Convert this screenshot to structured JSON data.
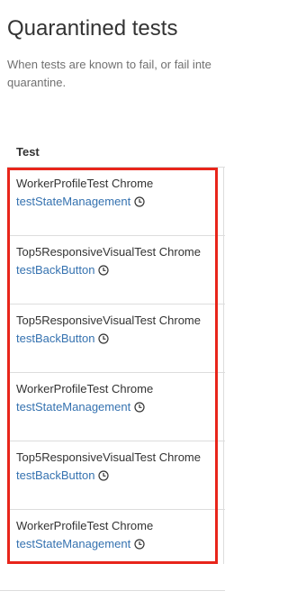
{
  "page": {
    "title": "Quarantined tests",
    "description_line1": "When tests are known to fail, or fail inte",
    "description_line2": "quarantine."
  },
  "table": {
    "header": "Test",
    "rows": [
      {
        "class_name": "WorkerProfileTest Chrome",
        "test_name": "testStateManagement",
        "icon": "clock-icon"
      },
      {
        "class_name": "Top5ResponsiveVisualTest Chrome",
        "test_name": "testBackButton",
        "icon": "clock-icon"
      },
      {
        "class_name": "Top5ResponsiveVisualTest Chrome",
        "test_name": "testBackButton",
        "icon": "clock-icon"
      },
      {
        "class_name": "WorkerProfileTest Chrome",
        "test_name": "testStateManagement",
        "icon": "clock-icon"
      },
      {
        "class_name": "Top5ResponsiveVisualTest Chrome",
        "test_name": "testBackButton",
        "icon": "clock-icon"
      },
      {
        "class_name": "WorkerProfileTest Chrome",
        "test_name": "testStateManagement",
        "icon": "clock-icon"
      }
    ]
  },
  "colors": {
    "link": "#3572b0",
    "highlight": "#e8251b",
    "border": "#dddddd"
  }
}
